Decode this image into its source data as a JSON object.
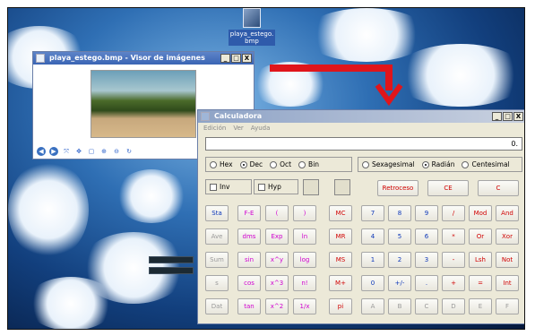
{
  "desktop": {
    "icon_label_line1": "playa_estego.",
    "icon_label_line2": "bmp"
  },
  "viewer": {
    "title": "playa_estego.bmp - Visor de imágenes",
    "min": "_",
    "max": "□",
    "close": "X"
  },
  "calculator": {
    "title": "Calculadora",
    "menu": [
      "Edición",
      "Ver",
      "Ayuda"
    ],
    "display_value": "0.",
    "bases": [
      {
        "label": "Hex",
        "selected": false
      },
      {
        "label": "Dec",
        "selected": true
      },
      {
        "label": "Oct",
        "selected": false
      },
      {
        "label": "Bin",
        "selected": false
      }
    ],
    "angles": [
      {
        "label": "Sexagesimal",
        "selected": false
      },
      {
        "label": "Radián",
        "selected": true
      },
      {
        "label": "Centesimal",
        "selected": false
      }
    ],
    "inv_label": "Inv",
    "hyp_label": "Hyp",
    "backspace": "Retroceso",
    "ce": "CE",
    "c": "C",
    "stat_col": [
      "Sta",
      "Ave",
      "Sum",
      "s",
      "Dat"
    ],
    "sci_rows": [
      [
        "F-E",
        "(",
        ")"
      ],
      [
        "dms",
        "Exp",
        "ln"
      ],
      [
        "sin",
        "x^y",
        "log"
      ],
      [
        "cos",
        "x^3",
        "n!"
      ],
      [
        "tan",
        "x^2",
        "1/x"
      ]
    ],
    "mem_col": [
      "MC",
      "MR",
      "MS",
      "M+",
      "pi"
    ],
    "num_rows": [
      [
        "7",
        "8",
        "9",
        "/",
        "Mod",
        "And"
      ],
      [
        "4",
        "5",
        "6",
        "*",
        "Or",
        "Xor"
      ],
      [
        "1",
        "2",
        "3",
        "-",
        "Lsh",
        "Not"
      ],
      [
        "0",
        "+/-",
        ".",
        "+",
        "=",
        "Int"
      ],
      [
        "A",
        "B",
        "C",
        "D",
        "E",
        "F"
      ]
    ]
  },
  "colors": {
    "operator_red": "#d00000",
    "digit_blue": "#0b36b8",
    "function_magenta": "#d000d0",
    "arrow_red": "#e0151b"
  }
}
